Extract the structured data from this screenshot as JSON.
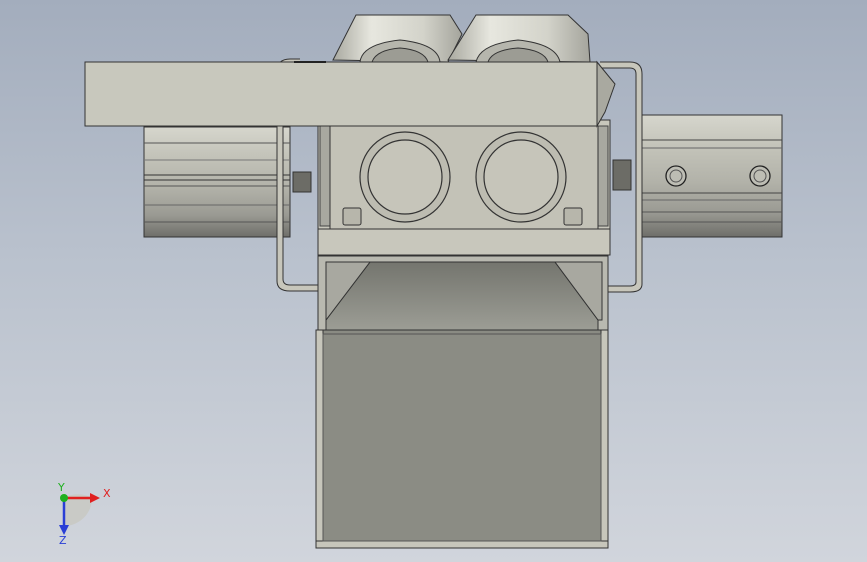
{
  "viewport": {
    "background_top": "#a3adbd",
    "background_bottom": "#d1d5dc"
  },
  "triad": {
    "x_label": "X",
    "y_label": "Y",
    "z_label": "Z",
    "x_color": "#e02020",
    "y_color": "#1fb01f",
    "z_color": "#2a3fd6"
  },
  "model": {
    "body_color": "#c9c8bd",
    "shadow_color": "#8d8e86",
    "edge_color": "#333333",
    "icons": [
      "coordinate-triad-icon"
    ]
  }
}
